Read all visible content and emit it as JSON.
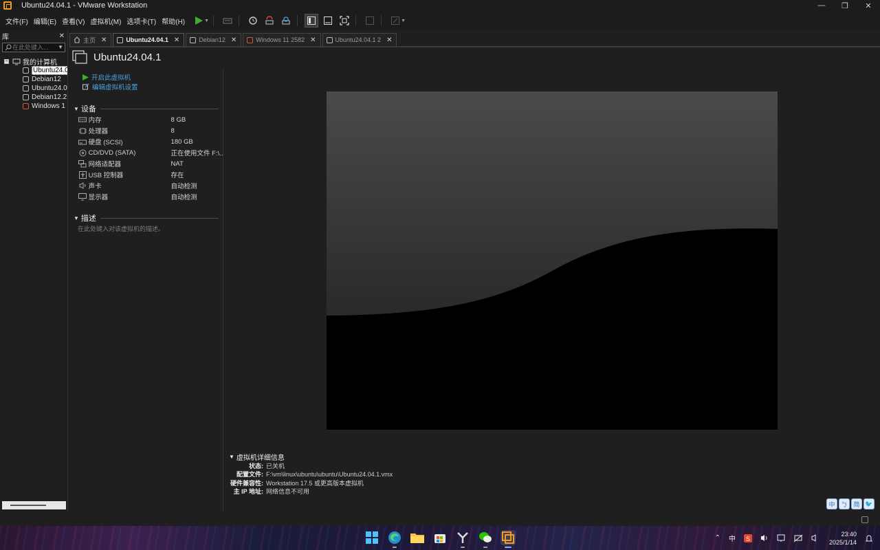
{
  "window": {
    "title": "Ubuntu24.04.1 - VMware Workstation"
  },
  "menu": [
    "文件(F)",
    "编辑(E)",
    "查看(V)",
    "虚拟机(M)",
    "选项卡(T)",
    "帮助(H)"
  ],
  "library": {
    "title": "库",
    "search_placeholder": "在此处键入...",
    "root": "我的计算机",
    "vms": [
      {
        "label": "Ubuntu24.0",
        "type": "linux",
        "selected": true
      },
      {
        "label": "Debian12",
        "type": "linux",
        "selected": false
      },
      {
        "label": "Ubuntu24.0",
        "type": "linux",
        "selected": false
      },
      {
        "label": "Debian12.2",
        "type": "linux",
        "selected": false
      },
      {
        "label": "Windows 1",
        "type": "windows",
        "selected": false
      }
    ]
  },
  "tabs": [
    {
      "label": "主页",
      "active": false,
      "icon": "home-icon"
    },
    {
      "label": "Ubuntu24.04.1",
      "active": true,
      "icon": "vm-icon"
    },
    {
      "label": "Debian12",
      "active": false,
      "icon": "vm-icon"
    },
    {
      "label": "Windows 11 2582",
      "active": false,
      "icon": "windows-vm-icon"
    },
    {
      "label": "Ubuntu24.04.1 2",
      "active": false,
      "icon": "vm-icon"
    }
  ],
  "vm": {
    "name": "Ubuntu24.04.1",
    "actions": {
      "power_on": "开启此虚拟机",
      "edit": "编辑虚拟机设置"
    },
    "devices_title": "设备",
    "devices": [
      {
        "icon": "memory-icon",
        "name": "内存",
        "value": "8 GB"
      },
      {
        "icon": "cpu-icon",
        "name": "处理器",
        "value": "8"
      },
      {
        "icon": "disk-icon",
        "name": "硬盘 (SCSI)",
        "value": "180 GB"
      },
      {
        "icon": "cd-icon",
        "name": "CD/DVD (SATA)",
        "value": "正在使用文件 F:\\..."
      },
      {
        "icon": "network-icon",
        "name": "网络适配器",
        "value": "NAT"
      },
      {
        "icon": "usb-icon",
        "name": "USB 控制器",
        "value": "存在"
      },
      {
        "icon": "sound-icon",
        "name": "声卡",
        "value": "自动检测"
      },
      {
        "icon": "display-icon",
        "name": "显示器",
        "value": "自动检测"
      }
    ],
    "description_title": "描述",
    "description_placeholder": "在此处键入对该虚拟机的描述。",
    "details": {
      "title": "虚拟机详细信息",
      "rows": [
        {
          "key": "状态:",
          "value": "已关机"
        },
        {
          "key": "配置文件:",
          "value": "F:\\vm\\linux\\ubuntu\\ubuntu\\Ubuntu24.04.1.vmx"
        },
        {
          "key": "硬件兼容性:",
          "value": "Workstation 17.5 或更高版本虚拟机"
        },
        {
          "key": "主 IP 地址:",
          "value": "网络信息不可用"
        }
      ]
    }
  },
  "ime": [
    "中",
    "ㄅ",
    "简",
    "🐦"
  ],
  "taskbar": {
    "tray_lang": "中",
    "clock_time": "23:40",
    "clock_date": "2025/1/14"
  },
  "colors": {
    "accent_orange": "#f29e1a",
    "link_blue": "#4aa3df",
    "play_green": "#3fae2a"
  }
}
